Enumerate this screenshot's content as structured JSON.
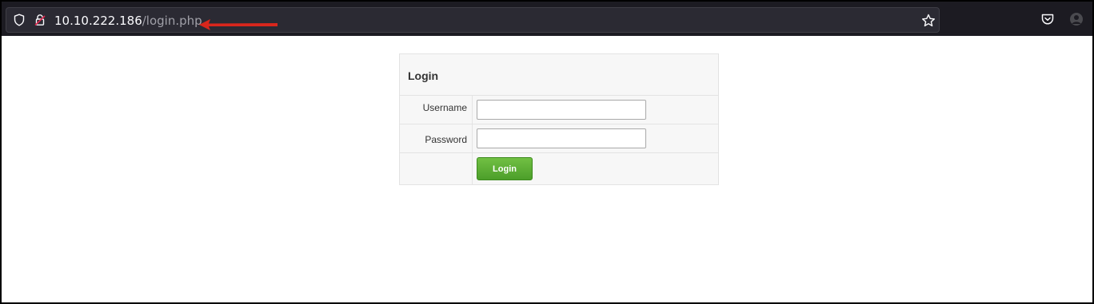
{
  "browser": {
    "url": {
      "host": "10.10.222.186",
      "path": "/login.php"
    },
    "icons": {
      "shield": "shield-icon",
      "lock": "insecure-lock-icon",
      "bookmark": "star-icon",
      "pocket": "pocket-icon",
      "account": "avatar-icon"
    },
    "annotation_color": "#d9261c"
  },
  "login_form": {
    "title": "Login",
    "username_label": "Username",
    "username_value": "",
    "password_label": "Password",
    "password_value": "",
    "submit_label": "Login"
  },
  "colors": {
    "toolbar_bg": "#1c1b22",
    "urlbar_bg": "#2b2a33",
    "button_green": "#5aac33"
  }
}
